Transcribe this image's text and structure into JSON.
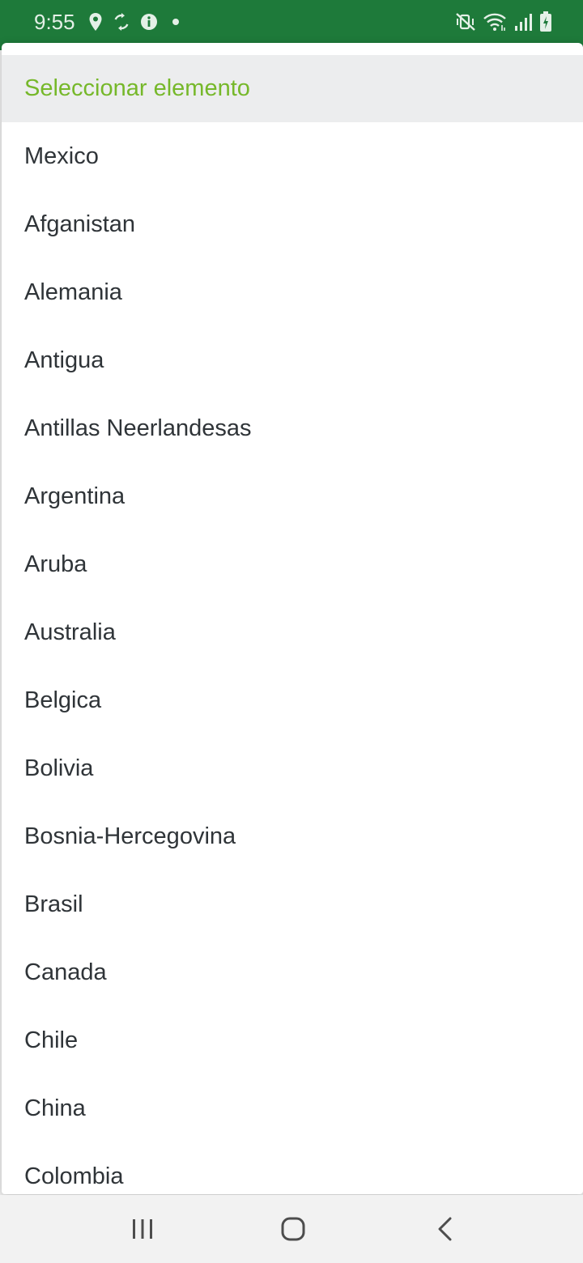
{
  "status_bar": {
    "time": "9:55",
    "background_color": "#1e7a3a",
    "left_icons": [
      "location-pin-icon",
      "sync-icon",
      "info-icon",
      "notification-dot-icon"
    ],
    "right_icons": [
      "mute-vibrate-icon",
      "wifi-icon",
      "signal-icon",
      "battery-charging-icon"
    ]
  },
  "dialog": {
    "title": "Seleccionar elemento",
    "title_color": "#76b82a",
    "items": [
      {
        "label": "Mexico"
      },
      {
        "label": "Afganistan"
      },
      {
        "label": "Alemania"
      },
      {
        "label": "Antigua"
      },
      {
        "label": "Antillas Neerlandesas"
      },
      {
        "label": "Argentina"
      },
      {
        "label": "Aruba"
      },
      {
        "label": "Australia"
      },
      {
        "label": "Belgica"
      },
      {
        "label": "Bolivia"
      },
      {
        "label": "Bosnia-Hercegovina"
      },
      {
        "label": "Brasil"
      },
      {
        "label": "Canada"
      },
      {
        "label": "Chile"
      },
      {
        "label": "China"
      },
      {
        "label": "Colombia"
      }
    ]
  },
  "nav_bar": {
    "buttons": [
      "recent-apps-icon",
      "home-icon",
      "back-icon"
    ]
  }
}
